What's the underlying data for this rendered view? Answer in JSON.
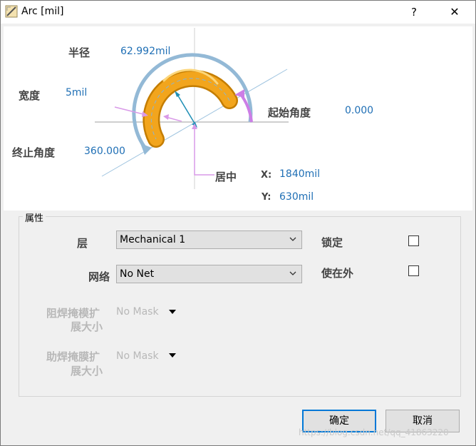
{
  "window": {
    "title": "Arc [mil]",
    "help": "?",
    "close": "✕"
  },
  "diagram": {
    "radius": {
      "label": "半径",
      "value": "62.992mil"
    },
    "width": {
      "label": "宽度",
      "value": "5mil"
    },
    "start_angle": {
      "label": "起始角度",
      "value": "0.000"
    },
    "end_angle": {
      "label": "终止角度",
      "value": "360.000"
    },
    "center": {
      "label": "居中",
      "x_label": "X:",
      "x_value": "1840mil",
      "y_label": "Y:",
      "y_value": "630mil"
    }
  },
  "properties": {
    "group_title": "属性",
    "layer": {
      "label": "层",
      "value": "Mechanical 1"
    },
    "net": {
      "label": "网络",
      "value": "No Net"
    },
    "lock": {
      "label": "锁定",
      "checked": false
    },
    "keepout": {
      "label": "使在外",
      "checked": false
    },
    "solder_mask": {
      "label_line1": "阻焊掩模扩",
      "label_line2": "展大小",
      "value": "No Mask"
    },
    "paste_mask": {
      "label_line1": "助焊掩膜扩",
      "label_line2": "展大小",
      "value": "No Mask"
    }
  },
  "buttons": {
    "ok": "确定",
    "cancel": "取消"
  },
  "watermark": "https://blog.csdn.net/qq_41863220",
  "colors": {
    "accent": "#1f6fb5",
    "arc_fill": "#f2a51d",
    "arc_outline": "#c47d00",
    "pink": "#d99ae8",
    "blue_arrow": "#8fb8d6"
  }
}
